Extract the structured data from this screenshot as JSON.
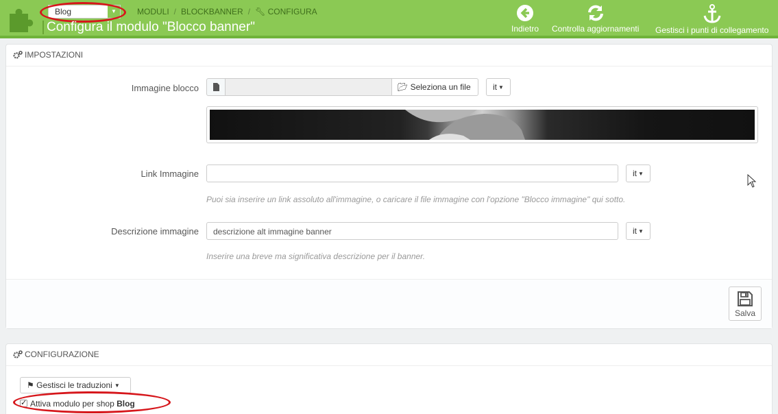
{
  "header": {
    "shop_selector_value": "Blog",
    "breadcrumb": [
      "MODULI",
      "BLOCKBANNER",
      "CONFIGURA"
    ],
    "page_title": "Configura il modulo \"Blocco banner\"",
    "toolbar": {
      "back_label": "Indietro",
      "updates_label": "Controlla aggiornamenti",
      "hooks_label": "Gestisci i punti di collegamento"
    }
  },
  "settings_panel": {
    "title": "IMPOSTAZIONI",
    "image_label": "Immagine blocco",
    "file_button_label": "Seleziona un file",
    "lang": "it",
    "link_label": "Link Immagine",
    "link_value": "",
    "link_help": "Puoi sia inserire un link assoluto all'immagine, o caricare il file immagine con l'opzione \"Blocco immagine\" qui sotto.",
    "desc_label": "Descrizione immagine",
    "desc_value": "descrizione alt immagine banner",
    "desc_help": "Inserire una breve ma significativa descrizione per il banner.",
    "save_label": "Salva"
  },
  "config_panel": {
    "title": "CONFIGURAZIONE",
    "translations_button": "Gestisci le traduzioni",
    "activate_prefix": "Attiva modulo per shop",
    "activate_shop": "Blog",
    "activate_checked": true
  },
  "colors": {
    "header_green": "#8bc954",
    "annotation_red": "#d6161b"
  }
}
